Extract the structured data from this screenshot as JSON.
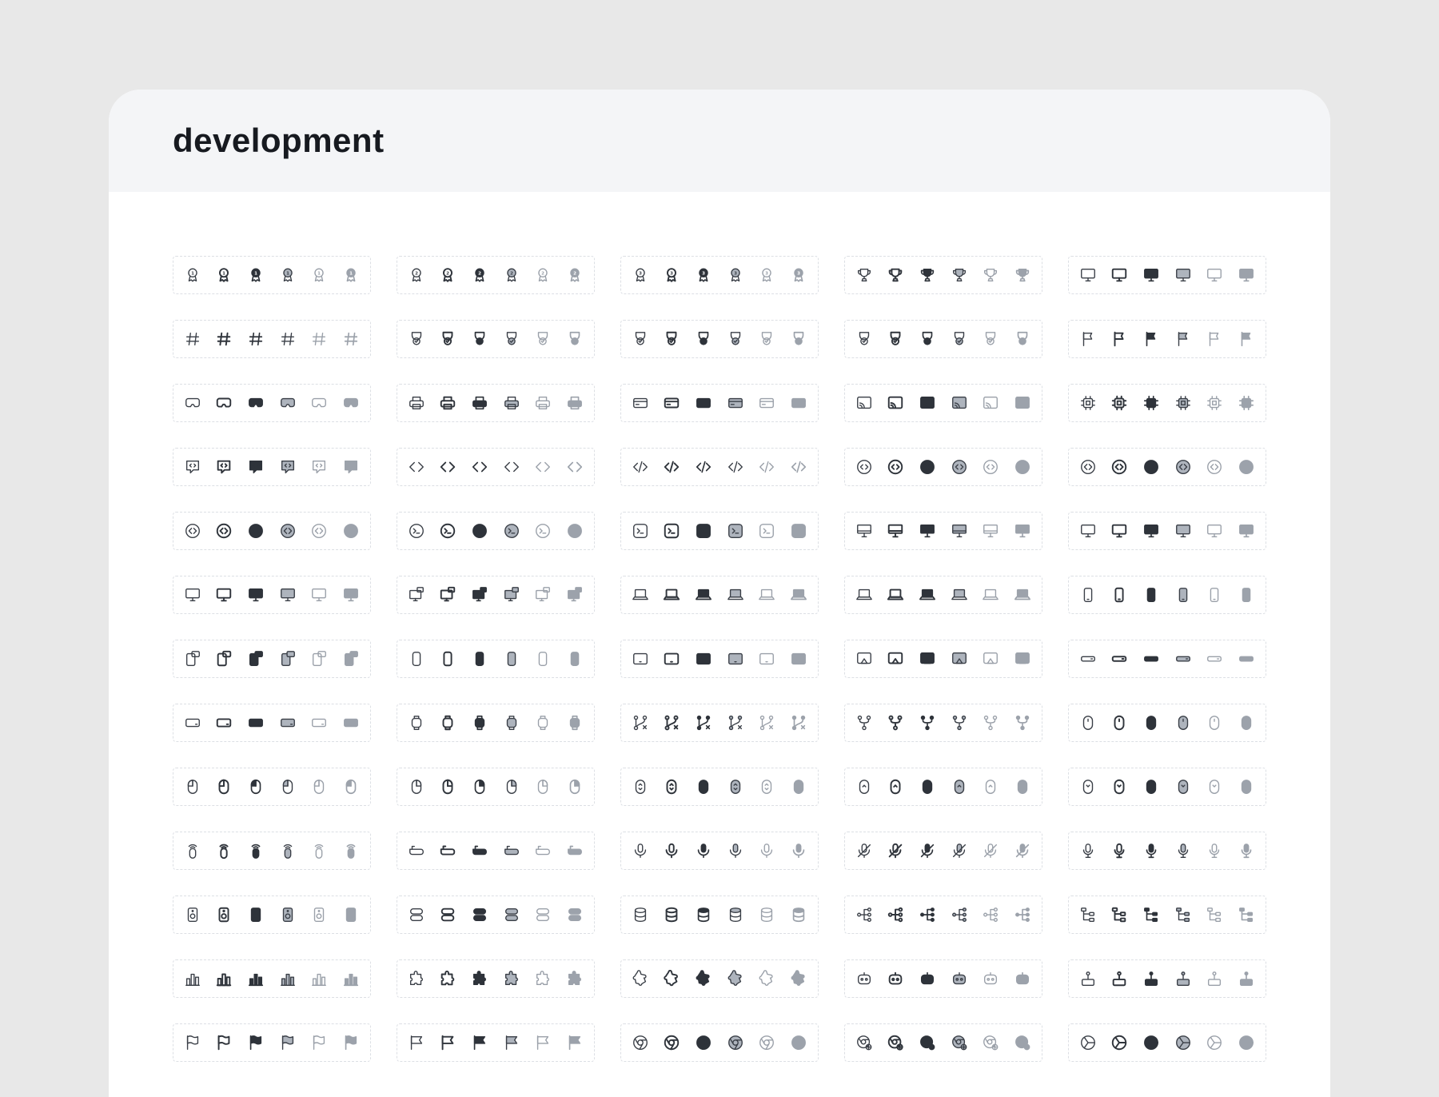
{
  "page": {
    "title": "development"
  },
  "style_variants": [
    {
      "name": "stroke",
      "color": "#3a3f47"
    },
    {
      "name": "stroke-bold",
      "color": "#30353c"
    },
    {
      "name": "solid",
      "color": "#2e333a"
    },
    {
      "name": "duotone",
      "color": "#3a3f47",
      "fill": "#aeb4bd"
    },
    {
      "name": "light",
      "color": "#9aa0a9"
    },
    {
      "name": "light-solid",
      "color": "#9ca2ab"
    }
  ],
  "icon_groups": [
    "medal-1",
    "medal-2",
    "medal-3",
    "trophy-star",
    "monitor",
    "hashtag",
    "award-star",
    "award-circle",
    "award-badge",
    "flag-square",
    "vr-headset",
    "printer",
    "credit-card",
    "cast",
    "cpu-chip",
    "code-message",
    "code-brackets",
    "code-slash",
    "code-circle",
    "code-circle-filled",
    "code-circle-outline",
    "terminal-circle",
    "terminal-square",
    "desktop",
    "monitor-small",
    "monitor-stand",
    "monitor-chat",
    "laptop",
    "laptop-open",
    "smartphone",
    "device-chat",
    "phone-portrait",
    "tablet-landscape",
    "airplay",
    "keyboard-bar",
    "tablet-wide",
    "smartwatch",
    "git-pull-request",
    "git-fork",
    "mouse",
    "mouse-left-click",
    "mouse-right-click",
    "mouse-scroll",
    "mouse-up",
    "mouse-down",
    "mouse-wireless",
    "cable",
    "microphone",
    "microphone-off",
    "microphone-alt",
    "speaker",
    "server",
    "database",
    "hierarchy",
    "tree-structure",
    "bar-chart",
    "puzzle",
    "puzzle-alt",
    "robot",
    "antenna-box",
    "flag-wave",
    "flag-alt",
    "chrome",
    "chrome-add",
    "chrome-alt"
  ]
}
